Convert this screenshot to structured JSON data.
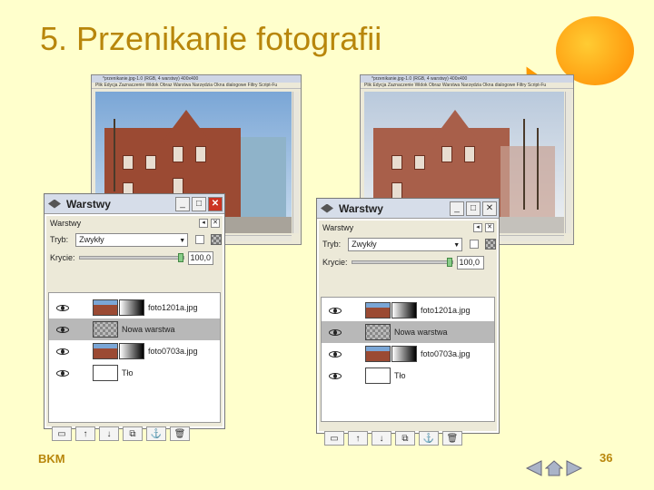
{
  "slide": {
    "title": "5. Przenikanie fotografii",
    "footer_left": "BKM",
    "page_number": "36"
  },
  "gimp_left": {
    "title": "*przenikanie.jpg-1.0 (RGB, 4 warstwy) 400x400",
    "menu": "Plik  Edycja  Zaznaczenie  Widok  Obraz  Warstwa  Narzędzia  Okna dialogowe  Filtry  Script-Fu"
  },
  "gimp_right": {
    "title": "*przenikanie.jpg-1.0 (RGB, 4 warstwy) 400x400",
    "menu": "Plik  Edycja  Zaznaczenie  Widok  Obraz  Warstwa  Narzędzia  Okna dialogowe  Filtry  Script-Fu"
  },
  "layers_left": {
    "window_title": "Warstwy",
    "subtitle": "Warstwy",
    "mode_label": "Tryb:",
    "mode_value": "Zwykły",
    "opacity_label": "Krycie:",
    "opacity_value": "100,0",
    "layers": [
      {
        "name": "foto1201a.jpg",
        "selected": false
      },
      {
        "name": "Nowa warstwa",
        "selected": true
      },
      {
        "name": "foto0703a.jpg",
        "selected": false
      },
      {
        "name": "Tło",
        "selected": false
      }
    ]
  },
  "layers_right": {
    "window_title": "Warstwy",
    "subtitle": "Warstwy",
    "mode_label": "Tryb:",
    "mode_value": "Zwykły",
    "opacity_label": "Krycie:",
    "opacity_value": "100,0",
    "layers": [
      {
        "name": "foto1201a.jpg",
        "selected": false
      },
      {
        "name": "Nowa warstwa",
        "selected": true
      },
      {
        "name": "foto0703a.jpg",
        "selected": false
      },
      {
        "name": "Tło",
        "selected": false
      }
    ]
  },
  "icons": {
    "minimize": "_",
    "maximize": "□",
    "close": "✕",
    "new_layer": "new-layer-icon",
    "raise": "↑",
    "lower": "↓",
    "duplicate": "duplicate-icon",
    "anchor": "⚓",
    "delete": "trash-icon"
  },
  "colors": {
    "background": "#ffffcc",
    "title": "#b8860b",
    "selected_row": "#b8b8b8"
  }
}
